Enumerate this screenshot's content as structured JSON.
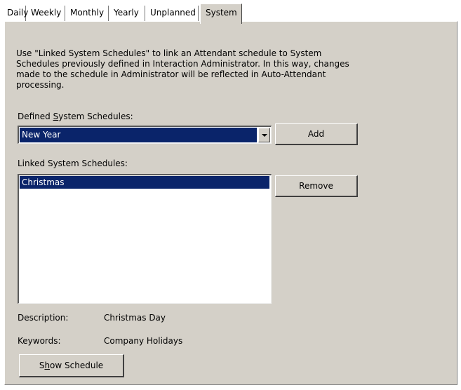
{
  "tabs": [
    {
      "label": "Daily",
      "active": false
    },
    {
      "label": "Weekly",
      "active": false
    },
    {
      "label": "Monthly",
      "active": false
    },
    {
      "label": "Yearly",
      "active": false
    },
    {
      "label": "Unplanned",
      "active": false
    },
    {
      "label": "System",
      "active": true
    }
  ],
  "intro_text": "Use \"Linked System Schedules\" to link an Attendant schedule to System Schedules previously defined in Interaction Administrator.  In this way, changes made to the schedule in Administrator will be reflected in Auto-Attendant processing.",
  "defined": {
    "label_pre": "Defined ",
    "label_mnemonic": "S",
    "label_post": "ystem Schedules:",
    "selected": "New Year",
    "add_label": "Add"
  },
  "linked": {
    "label": "Linked System Schedules:",
    "items": [
      "Christmas"
    ],
    "remove_label": "Remove"
  },
  "details": {
    "description_label": "Description:",
    "description_value": "Christmas Day",
    "keywords_label": "Keywords:",
    "keywords_value": "Company Holidays"
  },
  "show_schedule": {
    "pre": "S",
    "mnemonic": "h",
    "post": "ow Schedule"
  },
  "colors": {
    "panel": "#d4d0c8",
    "selection": "#0a246a"
  }
}
